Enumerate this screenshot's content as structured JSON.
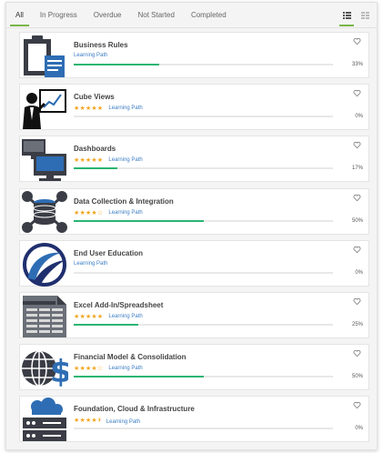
{
  "tabs": [
    {
      "label": "All",
      "active": true
    },
    {
      "label": "In Progress",
      "active": false
    },
    {
      "label": "Overdue",
      "active": false
    },
    {
      "label": "Not Started",
      "active": false
    },
    {
      "label": "Completed",
      "active": false
    }
  ],
  "view_toggle": {
    "list_icon": "list-view-icon",
    "grid_icon": "grid-view-icon",
    "active": "list"
  },
  "colors": {
    "accent": "#7ab648",
    "progress": "#29b573",
    "star": "#f2a623",
    "link": "#3b7dc4",
    "icon_dark": "#3a3d45",
    "icon_blue": "#2e6db4"
  },
  "courses": [
    {
      "title": "Business Rules",
      "type": "Learning Path",
      "rating": null,
      "progress": 33,
      "progress_label": "33%",
      "icon": "clipboard-icon"
    },
    {
      "title": "Cube Views",
      "type": "Learning Path",
      "rating": 5,
      "rating_display": "★★★★★",
      "progress": 0,
      "progress_label": "0%",
      "icon": "presenter-icon"
    },
    {
      "title": "Dashboards",
      "type": "Learning Path",
      "rating": 5,
      "rating_display": "★★★★★",
      "progress": 17,
      "progress_label": "17%",
      "icon": "monitors-icon"
    },
    {
      "title": "Data Collection & Integration",
      "type": "Learning Path",
      "rating": 4,
      "rating_display": "★★★★☆",
      "progress": 50,
      "progress_label": "50%",
      "icon": "database-network-icon"
    },
    {
      "title": "End User Education",
      "type": "Learning Path",
      "rating": null,
      "progress": 0,
      "progress_label": "0%",
      "icon": "swoosh-logo-icon"
    },
    {
      "title": "Excel Add-In/Spreadsheet",
      "type": "Learning Path",
      "rating": 5,
      "rating_display": "★★★★★",
      "progress": 25,
      "progress_label": "25%",
      "icon": "spreadsheet-icon"
    },
    {
      "title": "Financial Model & Consolidation",
      "type": "Learning Path",
      "rating": 4,
      "rating_display": "★★★★☆",
      "progress": 50,
      "progress_label": "50%",
      "icon": "globe-dollar-icon"
    },
    {
      "title": "Foundation, Cloud & Infrastructure",
      "type": "Learning Path",
      "rating": 4.5,
      "rating_display": "★★★★⯨",
      "progress": 0,
      "progress_label": "0%",
      "icon": "cloud-server-icon"
    }
  ]
}
